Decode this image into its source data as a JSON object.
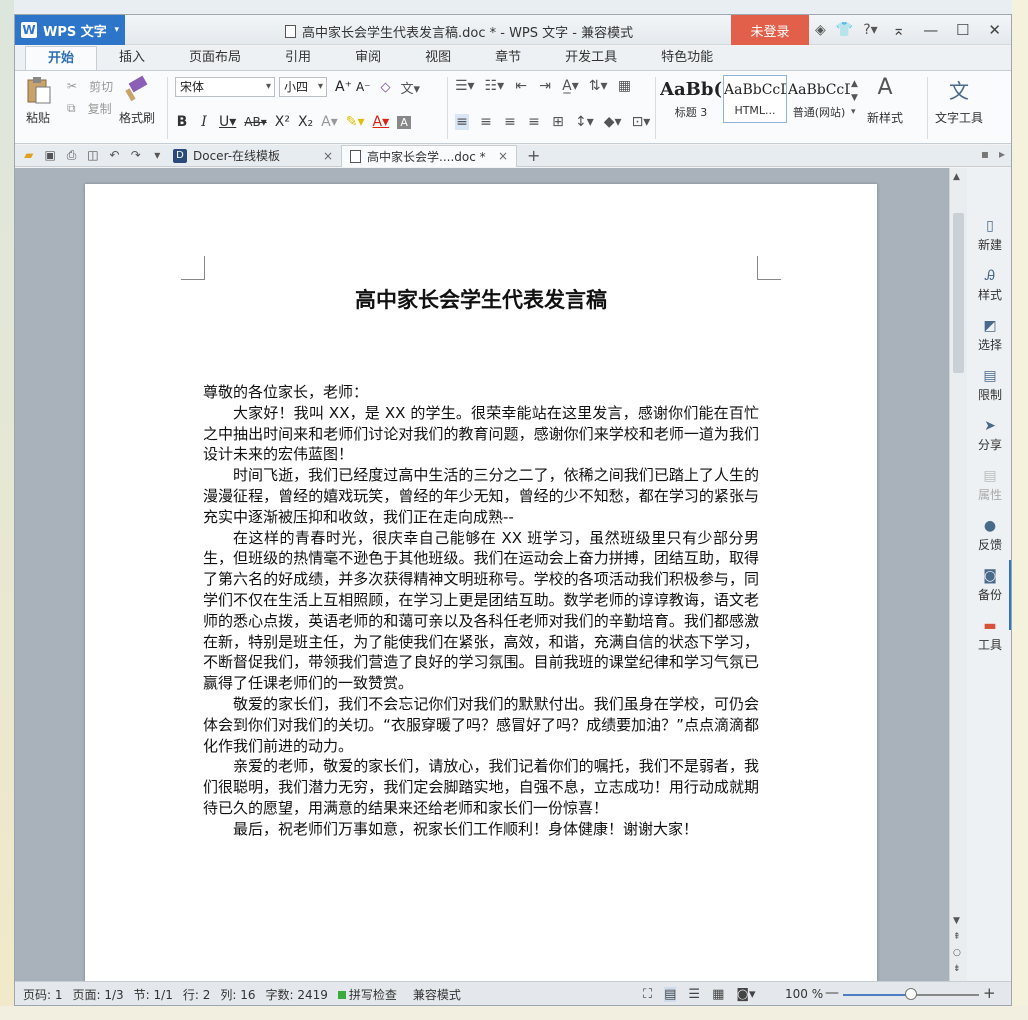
{
  "window": {
    "app_name": "WPS 文字",
    "title": "高中家长会学生代表发言稿.doc * - WPS 文字 - 兼容模式",
    "login_label": "未登录"
  },
  "ribbon_tabs": [
    "开始",
    "插入",
    "页面布局",
    "引用",
    "审阅",
    "视图",
    "章节",
    "开发工具",
    "特色功能"
  ],
  "ribbon": {
    "paste": "粘贴",
    "cut": "剪切",
    "copy": "复制",
    "format_painter": "格式刷",
    "font_name": "宋体",
    "font_size": "小四",
    "styles": [
      {
        "sample": "AaBb(",
        "name": "标题 3"
      },
      {
        "sample": "AaBbCcD",
        "name": "HTML..."
      },
      {
        "sample": "AaBbCcD",
        "name": "普通(网站)"
      }
    ],
    "new_style": "新样式",
    "text_tools": "文字工具"
  },
  "doc_tabs": [
    {
      "label": "Docer-在线模板",
      "active": false
    },
    {
      "label": "高中家长会学....doc *",
      "active": true
    }
  ],
  "document": {
    "title": "高中家长会学生代表发言稿",
    "paragraphs": [
      {
        "indent": false,
        "text": "尊敬的各位家长，老师："
      },
      {
        "indent": true,
        "text": "大家好！我叫 XX，是 XX 的学生。很荣幸能站在这里发言，感谢你们能在百忙之中抽出时间来和老师们讨论对我们的教育问题，感谢你们来学校和老师一道为我们设计未来的宏伟蓝图！"
      },
      {
        "indent": true,
        "text": "时间飞逝，我们已经度过高中生活的三分之二了，依稀之间我们已踏上了人生的漫漫征程，曾经的嬉戏玩笑，曾经的年少无知，曾经的少不知愁，都在学习的紧张与充实中逐渐被压抑和收敛，我们正在走向成熟--"
      },
      {
        "indent": true,
        "text": "在这样的青春时光，很庆幸自己能够在 XX 班学习，虽然班级里只有少部分男生，但班级的热情毫不逊色于其他班级。我们在运动会上奋力拼搏，团结互助，取得了第六名的好成绩，并多次获得精神文明班称号。学校的各项活动我们积极参与，同学们不仅在生活上互相照顾，在学习上更是团结互助。数学老师的谆谆教诲，语文老师的悉心点拨，英语老师的和蔼可亲以及各科任老师对我们的辛勤培育。我们都感激在新，特别是班主任，为了能使我们在紧张，高效，和谐，充满自信的状态下学习，不断督促我们，带领我们营造了良好的学习氛围。目前我班的课堂纪律和学习气氛已赢得了任课老师们的一致赞赏。"
      },
      {
        "indent": true,
        "text": "敬爱的家长们，我们不会忘记你们对我们的默默付出。我们虽身在学校，可仍会体会到你们对我们的关切。“衣服穿暖了吗？感冒好了吗？成绩要加油？”点点滴滴都化作我们前进的动力。"
      },
      {
        "indent": true,
        "text": "亲爱的老师，敬爱的家长们，请放心，我们记着你们的嘱托，我们不是弱者，我们很聪明，我们潜力无穷，我们定会脚踏实地，自强不息，立志成功！用行动成就期待已久的愿望，用满意的结果来还给老师和家长们一份惊喜！"
      },
      {
        "indent": true,
        "text": " 最后，祝老师们万事如意，祝家长们工作顺利！身体健康！谢谢大家！"
      }
    ]
  },
  "side_panel": [
    {
      "label": "新建",
      "icon": "new-doc-icon",
      "state": "normal"
    },
    {
      "label": "样式",
      "icon": "style-icon",
      "state": "normal"
    },
    {
      "label": "选择",
      "icon": "select-icon",
      "state": "normal"
    },
    {
      "label": "限制",
      "icon": "restrict-icon",
      "state": "normal"
    },
    {
      "label": "分享",
      "icon": "share-icon",
      "state": "normal"
    },
    {
      "label": "属性",
      "icon": "properties-icon",
      "state": "dim"
    },
    {
      "label": "反馈",
      "icon": "feedback-icon",
      "state": "normal"
    },
    {
      "label": "备份",
      "icon": "backup-icon",
      "state": "normal"
    },
    {
      "label": "工具",
      "icon": "toolbox-icon",
      "state": "red"
    }
  ],
  "status": {
    "page_no": "页码: 1",
    "pages": "页面: 1/3",
    "section": "节: 1/1",
    "row": "行: 2",
    "col": "列: 16",
    "word_count": "字数: 2419",
    "spell_check": "拼写检查",
    "compat": "兼容模式",
    "zoom": "100 %",
    "zoom_level_fraction": 0.5
  },
  "colors": {
    "accent": "#2d75c9",
    "login": "#e2604a"
  }
}
